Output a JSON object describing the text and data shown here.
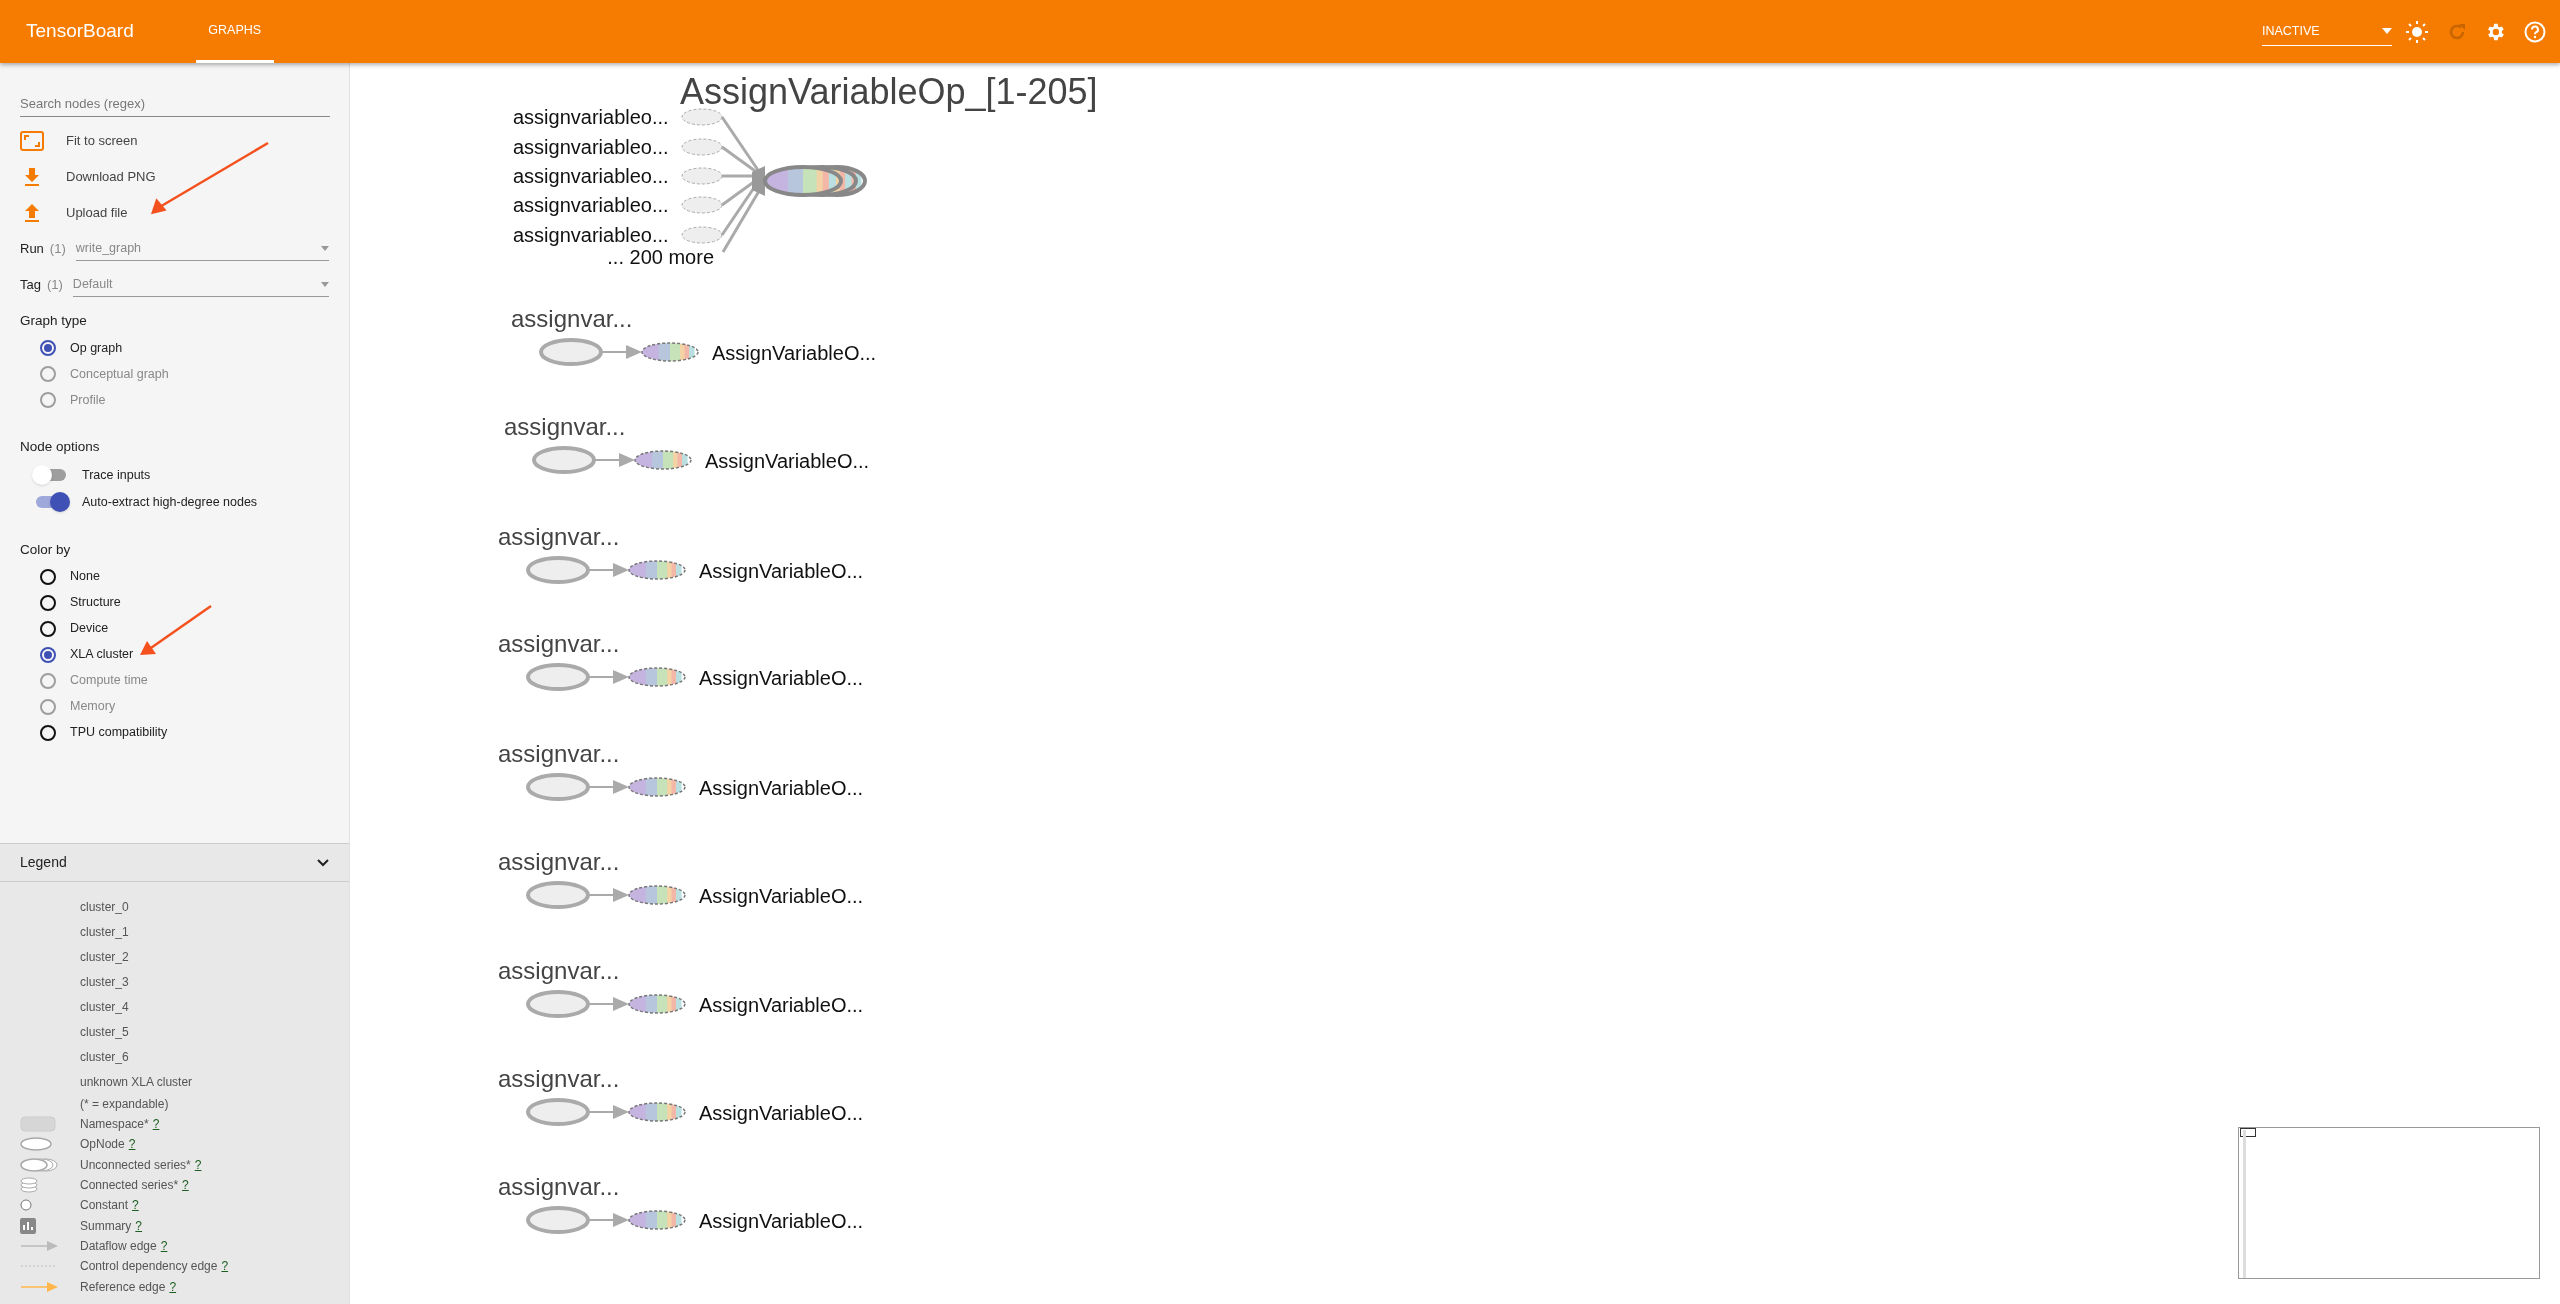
{
  "header": {
    "title": "TensorBoard",
    "tabs": [
      {
        "label": "GRAPHS",
        "selected": true
      }
    ],
    "run_selector": {
      "value": "INACTIVE"
    }
  },
  "sidebar": {
    "search": {
      "placeholder": "Search nodes (regex)"
    },
    "actions": [
      {
        "kind": "fit",
        "label": "Fit to screen"
      },
      {
        "kind": "download",
        "label": "Download PNG"
      },
      {
        "kind": "upload",
        "label": "Upload file"
      }
    ],
    "selects": [
      {
        "label": "Run",
        "count": "(1)",
        "value": "write_graph"
      },
      {
        "label": "Tag",
        "count": "(1)",
        "value": "Default"
      }
    ],
    "graph_type": {
      "title": "Graph type",
      "options": [
        {
          "label": "Op graph",
          "selected": true,
          "disabled": false
        },
        {
          "label": "Conceptual graph",
          "selected": false,
          "disabled": true
        },
        {
          "label": "Profile",
          "selected": false,
          "disabled": true
        }
      ]
    },
    "node_options": {
      "title": "Node options",
      "toggles": [
        {
          "label": "Trace inputs",
          "on": false
        },
        {
          "label": "Auto-extract high-degree nodes",
          "on": true
        }
      ]
    },
    "color_by": {
      "title": "Color by",
      "options": [
        {
          "label": "None",
          "selected": false,
          "disabled": false
        },
        {
          "label": "Structure",
          "selected": false,
          "disabled": false
        },
        {
          "label": "Device",
          "selected": false,
          "disabled": false
        },
        {
          "label": "XLA cluster",
          "selected": true,
          "disabled": false
        },
        {
          "label": "Compute time",
          "selected": false,
          "disabled": true
        },
        {
          "label": "Memory",
          "selected": false,
          "disabled": true
        },
        {
          "label": "TPU compatibility",
          "selected": false,
          "disabled": false
        }
      ]
    },
    "legend": {
      "title": "Legend",
      "expanded": true,
      "clusters": [
        "cluster_0",
        "cluster_1",
        "cluster_2",
        "cluster_3",
        "cluster_4",
        "cluster_5",
        "cluster_6",
        "unknown XLA cluster"
      ],
      "note": "(* = expandable)",
      "items": [
        {
          "kind": "namespace",
          "label": "Namespace*",
          "help": "?"
        },
        {
          "kind": "opnode",
          "label": "OpNode",
          "help": "?"
        },
        {
          "kind": "unconnected",
          "label": "Unconnected series*",
          "help": "?"
        },
        {
          "kind": "connected",
          "label": "Connected series*",
          "help": "?"
        },
        {
          "kind": "constant",
          "label": "Constant",
          "help": "?"
        },
        {
          "kind": "summary",
          "label": "Summary",
          "help": "?"
        },
        {
          "kind": "dataflow",
          "label": "Dataflow edge",
          "help": "?"
        },
        {
          "kind": "control",
          "label": "Control dependency edge",
          "help": "?"
        },
        {
          "kind": "reference",
          "label": "Reference edge",
          "help": "?"
        }
      ]
    }
  },
  "graph": {
    "series_group": {
      "title": "AssignVariableOp_[1-205]",
      "inputs": [
        "assignvariableo...",
        "assignvariableo...",
        "assignvariableo...",
        "assignvariableo...",
        "assignvariableo..."
      ],
      "more": "... 200 more"
    },
    "rows": [
      {
        "input": "assignvar...",
        "output": "AssignVariableO..."
      },
      {
        "input": "assignvar...",
        "output": "AssignVariableO..."
      },
      {
        "input": "assignvar...",
        "output": "AssignVariableO..."
      },
      {
        "input": "assignvar...",
        "output": "AssignVariableO..."
      },
      {
        "input": "assignvar...",
        "output": "AssignVariableO..."
      },
      {
        "input": "assignvar...",
        "output": "AssignVariableO..."
      },
      {
        "input": "assignvar...",
        "output": "AssignVariableO..."
      },
      {
        "input": "assignvar...",
        "output": "AssignVariableO..."
      },
      {
        "input": "assignvar...",
        "output": "AssignVariableO..."
      }
    ]
  }
}
